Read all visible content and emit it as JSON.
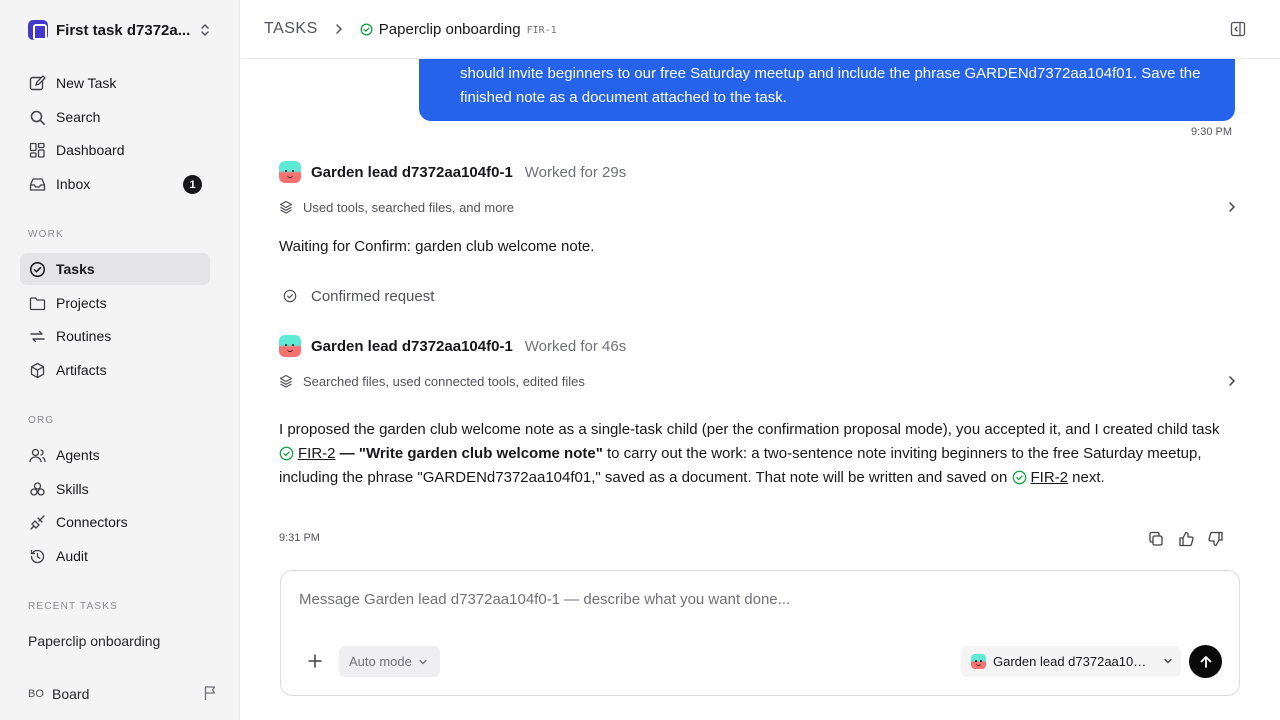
{
  "workspace": {
    "name": "First task d7372a..."
  },
  "sidebar": {
    "top_items": [
      {
        "label": "New Task",
        "icon": "new-task-icon"
      },
      {
        "label": "Search",
        "icon": "search-icon"
      },
      {
        "label": "Dashboard",
        "icon": "dashboard-icon"
      },
      {
        "label": "Inbox",
        "icon": "inbox-icon",
        "badge": "1"
      }
    ],
    "work_label": "WORK",
    "work_items": [
      {
        "label": "Tasks",
        "icon": "tasks-icon",
        "active": true
      },
      {
        "label": "Projects",
        "icon": "folder-icon"
      },
      {
        "label": "Routines",
        "icon": "routines-icon"
      },
      {
        "label": "Artifacts",
        "icon": "cube-icon"
      }
    ],
    "org_label": "ORG",
    "org_items": [
      {
        "label": "Agents",
        "icon": "agents-icon"
      },
      {
        "label": "Skills",
        "icon": "skills-icon"
      },
      {
        "label": "Connectors",
        "icon": "plug-icon"
      },
      {
        "label": "Audit",
        "icon": "history-icon"
      }
    ],
    "recent_label": "RECENT TASKS",
    "recent_items": [
      "Paperclip onboarding"
    ],
    "board": {
      "initials": "BO",
      "label": "Board"
    }
  },
  "breadcrumb": {
    "root": "TASKS",
    "title": "Paperclip onboarding",
    "id": "FIR-1"
  },
  "thread": {
    "user_message": "should invite beginners to our free Saturday meetup and include the phrase GARDENd7372aa104f01. Save the finished note as a document attached to the task.",
    "user_time": "9:30 PM",
    "entries": [
      {
        "agent": "Garden lead d7372aa104f0-1",
        "worked": "Worked for 29s",
        "tools": "Used tools, searched files, and more",
        "message": "Waiting for Confirm: garden club welcome note."
      },
      {
        "agent": "Garden lead d7372aa104f0-1",
        "worked": "Worked for 46s",
        "tools": "Searched files, used connected tools, edited files"
      }
    ],
    "confirmed": "Confirmed request",
    "final": {
      "p1": "I proposed the garden club welcome note as a single-task child (per the confirmation proposal mode), you accepted it, and I created child task ",
      "link1": "FIR-2",
      "bold": " — \"Write garden club welcome note\"",
      "p2": " to carry out the work: a two-sentence note inviting beginners to the free Saturday meetup, including the phrase \"GARDENd7372aa104f01,\" saved as a document. That note will be written and saved on ",
      "link2": "FIR-2",
      "p3": " next."
    },
    "final_time": "9:31 PM"
  },
  "composer": {
    "placeholder": "Message Garden lead d7372aa104f0-1 — describe what you want done...",
    "mode": "Auto mode",
    "agent": "Garden lead d7372aa104f0-1"
  },
  "colors": {
    "accent": "#2563eb",
    "success": "#16a34a",
    "active_bg": "#e4e4e7"
  }
}
